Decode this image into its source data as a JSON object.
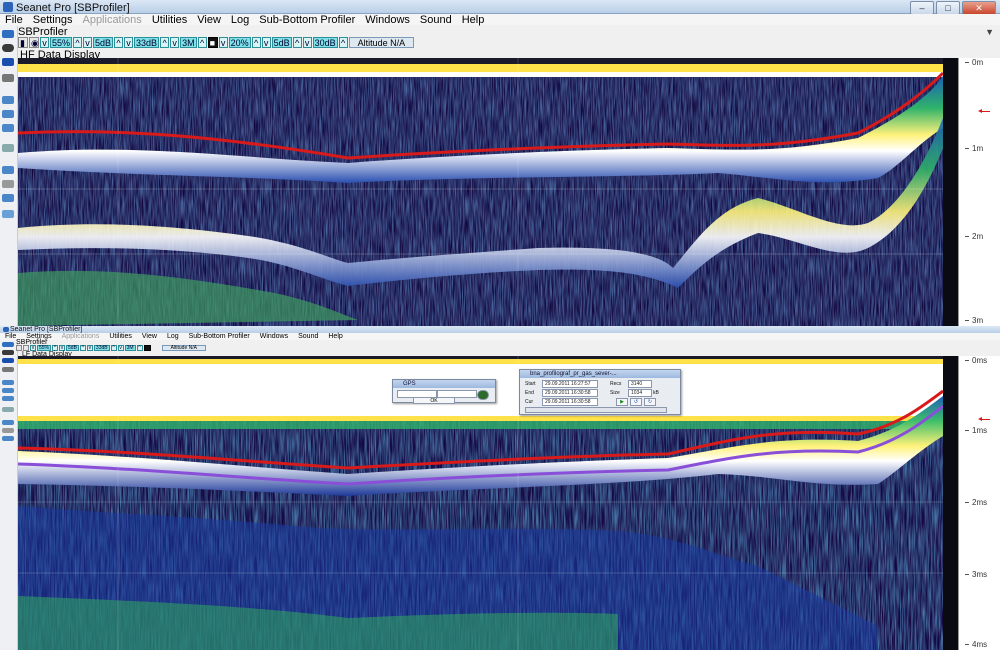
{
  "top_window": {
    "title": "Seanet Pro [SBProfiler]",
    "menu": [
      "File",
      "Settings",
      "Applications",
      "Utilities",
      "View",
      "Log",
      "Sub-Bottom Profiler",
      "Windows",
      "Sound",
      "Help"
    ],
    "panel_title": "SBProfiler",
    "toolbar": {
      "items": [
        "55%",
        "5dB",
        "33dB",
        "3M",
        "20%",
        "5dB",
        "30dB"
      ],
      "altitude": "Altitude N/A"
    },
    "display_label": "HF Data Display",
    "scale": [
      "0m",
      "1m",
      "2m",
      "3m"
    ]
  },
  "bottom_window": {
    "title": "Seanet Pro [SBProfiler]",
    "menu": [
      "File",
      "Settings",
      "Applications",
      "Utilities",
      "View",
      "Log",
      "Sub-Bottom Profiler",
      "Windows",
      "Sound",
      "Help"
    ],
    "panel_title": "SBProfiler",
    "toolbar": {
      "items": [
        "55%",
        "5dB",
        "33dB",
        "3M"
      ],
      "altitude": "Altitude N/A"
    },
    "display_label": "LF Data Display",
    "scale": [
      "0ms",
      "1ms",
      "2ms",
      "3ms",
      "4ms"
    ]
  },
  "gps_dialog": {
    "title": "GPS",
    "ok": "OK"
  },
  "replay_dialog": {
    "title": "bna_profilograf_pr_gas_sever-...",
    "start_label": "Start",
    "start_value": "29.09.2011 16:27:57",
    "end_label": "End",
    "end_value": "29.09.2011 16:30:58",
    "cur_label": "Cur",
    "cur_value": "29.09.2011 16:30:58",
    "recs_label": "Recs",
    "recs_value": "3140",
    "size_label": "Size",
    "size_value": "1034",
    "size_unit": "kB"
  },
  "colors": {
    "bottom_line": "#d81a1a",
    "subbottom_line": "#8a4fd8",
    "toolbar_button": "#7fe2e6",
    "echo_background": "#10063a"
  }
}
